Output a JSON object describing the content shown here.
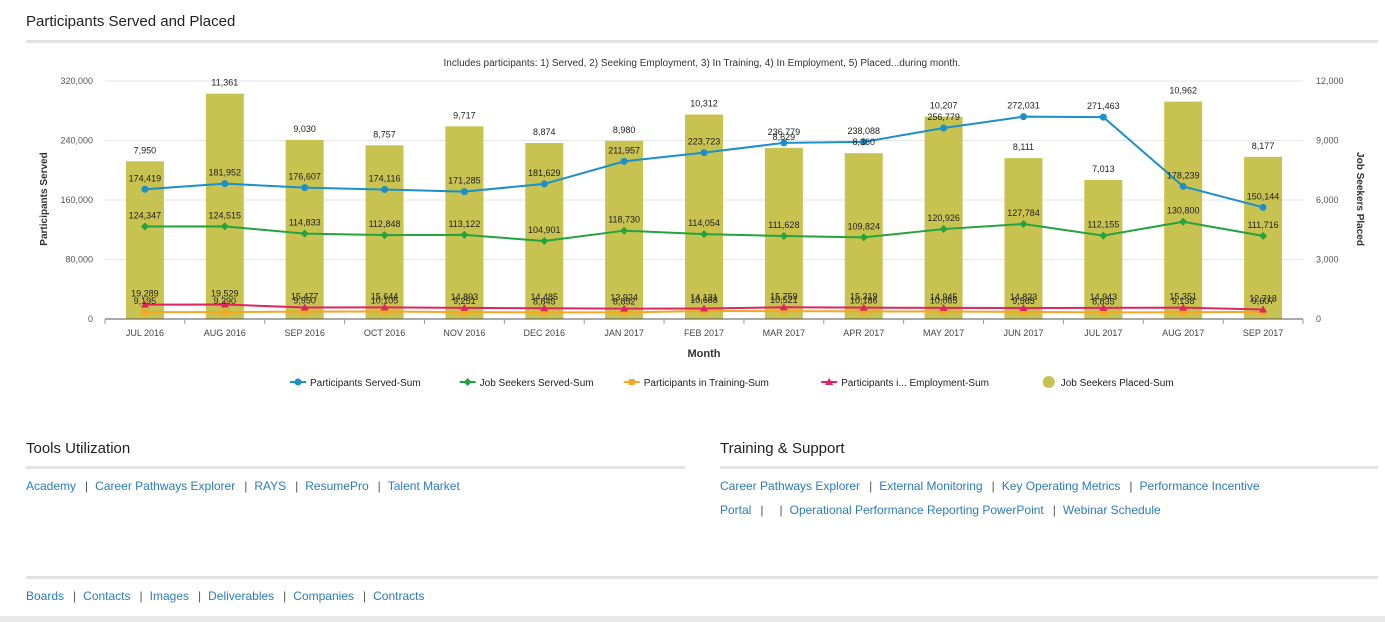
{
  "header": {
    "title": "Participants Served and Placed"
  },
  "chart_data": {
    "type": "bar+line",
    "subtitle": "Includes participants: 1) Served, 2) Seeking Employment, 3) In Training, 4) In Employment, 5) Placed...during month.",
    "xlabel": "Month",
    "ylabel_left": "Participants Served",
    "ylabel_right": "Job Seekers Placed",
    "ylim_left": [
      0,
      320000
    ],
    "ylim_right": [
      0,
      12000
    ],
    "yticks_left": [
      "320,000",
      "240,000",
      "160,000",
      "80,000",
      "0"
    ],
    "yticks_right": [
      "12,000",
      "9,000",
      "6,000",
      "3,000",
      "0"
    ],
    "categories": [
      "JUL 2016",
      "AUG 2016",
      "SEP 2016",
      "OCT 2016",
      "NOV 2016",
      "DEC 2016",
      "JAN 2017",
      "FEB 2017",
      "MAR 2017",
      "APR 2017",
      "MAY 2017",
      "JUN 2017",
      "JUL 2017",
      "AUG 2017",
      "SEP 2017"
    ],
    "bars": {
      "name": "Job Seekers Placed-Sum",
      "axis": "right",
      "color": "#c8c250",
      "values": [
        7950,
        11361,
        9030,
        8757,
        9717,
        8874,
        8980,
        10312,
        8629,
        8360,
        10207,
        8111,
        7013,
        10962,
        8177
      ]
    },
    "series": [
      {
        "name": "Participants Served-Sum",
        "axis": "left",
        "color": "#1a8fc9",
        "marker": "circle",
        "values": [
          174419,
          181952,
          176607,
          174116,
          171285,
          181629,
          211957,
          223723,
          236779,
          238088,
          256779,
          272031,
          271463,
          178239,
          150144
        ]
      },
      {
        "name": "Job Seekers Served-Sum",
        "axis": "left",
        "color": "#22a33c",
        "marker": "diamond",
        "values": [
          124347,
          124515,
          114833,
          112848,
          113122,
          104901,
          118730,
          114054,
          111628,
          109824,
          120926,
          127784,
          112155,
          130800,
          111716
        ]
      },
      {
        "name": "Participants in Training-Sum",
        "axis": "left",
        "color": "#f5a623",
        "marker": "square",
        "values": [
          9195,
          9290,
          9950,
          10105,
          9251,
          8845,
          8852,
          10688,
          10521,
          10186,
          10065,
          9565,
          8835,
          9138,
          9607
        ]
      },
      {
        "name": "Participants i... Employment-Sum",
        "axis": "left",
        "color": "#e0245e",
        "marker": "triangle",
        "values": [
          19289,
          19529,
          15477,
          15644,
          14893,
          14485,
          13924,
          14131,
          15759,
          15319,
          14945,
          14823,
          14943,
          15351,
          12713
        ]
      }
    ],
    "legend": [
      "Participants Served-Sum",
      "Job Seekers Served-Sum",
      "Participants in Training-Sum",
      "Participants i... Employment-Sum",
      "Job Seekers Placed-Sum"
    ],
    "legend_position": "bottom",
    "grid": true
  },
  "tools": {
    "title": "Tools Utilization",
    "links": [
      "Academy",
      "Career Pathways Explorer",
      "RAYS",
      "ResumePro",
      "Talent Market"
    ]
  },
  "training": {
    "title": "Training & Support",
    "links": [
      "Career Pathways Explorer",
      "External Monitoring",
      "Key Operating Metrics",
      "Performance Incentive Portal",
      "Operational Performance Reporting PowerPoint",
      "Webinar Schedule"
    ]
  },
  "footer": {
    "links": [
      "Boards",
      "Contacts",
      "Images",
      "Deliverables",
      "Companies",
      "Contracts"
    ]
  }
}
